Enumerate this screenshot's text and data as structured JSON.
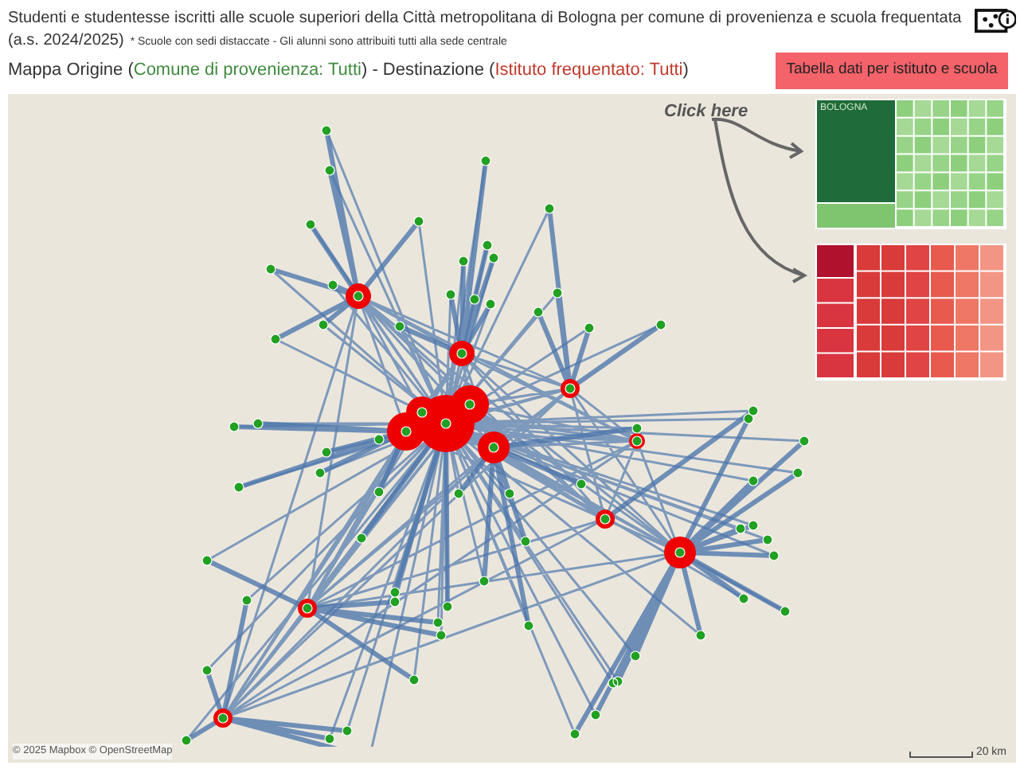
{
  "header": {
    "title": "Studenti e studentesse iscritti alle scuole superiori della Città metropolitana di Bologna per comune di provenienza e scuola frequentata",
    "year": "(a.s. 2024/2025)",
    "note": "* Scuole con sedi distaccate - Gli alunni sono attribuiti tutti alla sede centrale"
  },
  "subtitle": [
    {
      "text": "Mappa Origine (",
      "color": "#333333"
    },
    {
      "text": "Comune di provenienza: Tutti",
      "color": "#3f8a3f"
    },
    {
      "text": ") - Destinazione (",
      "color": "#333333"
    },
    {
      "text": "Istituto frequentato: Tutti",
      "color": "#c0392b"
    },
    {
      "text": ")",
      "color": "#333333"
    }
  ],
  "table_button": {
    "label": "Tabella dati per istituto e scuola"
  },
  "map": {
    "annotation": "Click here",
    "treemaps": [
      {
        "kind": "origin",
        "label": "BOLOGNA"
      },
      {
        "kind": "destination"
      }
    ],
    "scale": "20 km",
    "attribution": "© 2025 Mapbox © OpenStreetMap"
  }
}
